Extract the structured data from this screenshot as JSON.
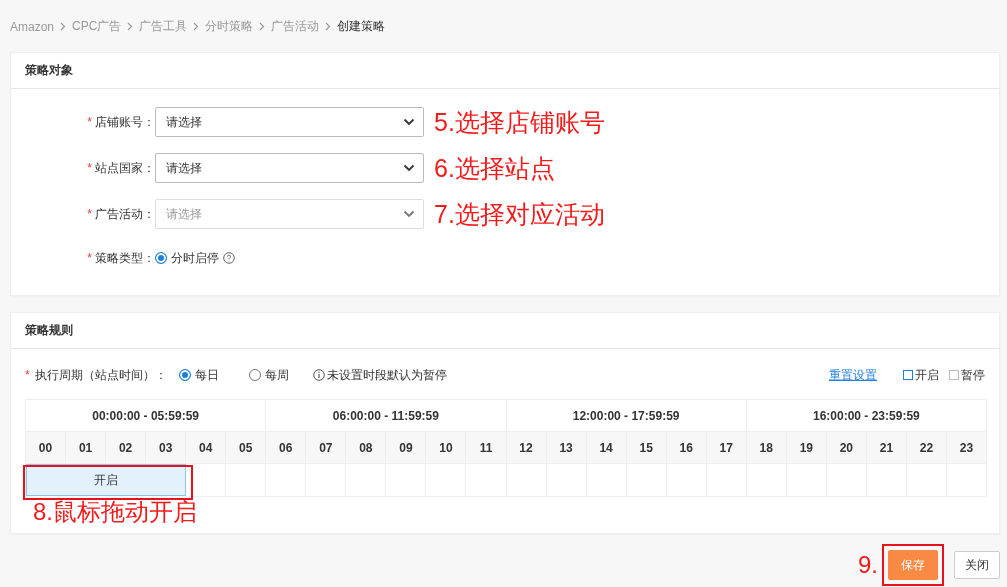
{
  "breadcrumb": [
    {
      "label": "Amazon",
      "current": false
    },
    {
      "label": "CPC广告",
      "current": false
    },
    {
      "label": "广告工具",
      "current": false
    },
    {
      "label": "分时策略",
      "current": false
    },
    {
      "label": "广告活动",
      "current": false
    },
    {
      "label": "创建策略",
      "current": true
    }
  ],
  "target_section": {
    "title": "策略对象",
    "fields": [
      {
        "kind": "select",
        "label": "店铺账号：",
        "required_mark": "*",
        "placeholder": "请选择",
        "disabled": false,
        "annotation": "5.选择店铺账号"
      },
      {
        "kind": "select",
        "label": "站点国家：",
        "required_mark": "*",
        "placeholder": "请选择",
        "disabled": false,
        "annotation": "6.选择站点"
      },
      {
        "kind": "select",
        "label": "广告活动：",
        "required_mark": "*",
        "placeholder": "请选择",
        "disabled": true,
        "annotation": "7.选择对应活动"
      },
      {
        "kind": "radio",
        "label": "策略类型：",
        "required_mark": "*",
        "options": [
          {
            "label": "分时启停",
            "selected": true
          }
        ]
      }
    ]
  },
  "rules_section": {
    "title": "策略规则",
    "period_label": "执行周期（站点时间）：",
    "period_required_mark": "*",
    "period_options": [
      {
        "label": "每日",
        "selected": true
      },
      {
        "label": "每周",
        "selected": false
      }
    ],
    "hint": "未设置时段默认为暂停",
    "reset_link": "重置设置",
    "legend": [
      {
        "label": "开启",
        "kind": "on"
      },
      {
        "label": "暂停",
        "kind": "off"
      }
    ],
    "ranges": [
      "00:00:00 - 05:59:59",
      "06:00:00 - 11:59:59",
      "12:00:00 - 17:59:59",
      "16:00:00 - 23:59:59"
    ],
    "hours": [
      {
        "label": "00",
        "on": true
      },
      {
        "label": "01",
        "on": true
      },
      {
        "label": "02",
        "on": true
      },
      {
        "label": "03",
        "on": true
      },
      {
        "label": "04",
        "on": false
      },
      {
        "label": "05",
        "on": false
      },
      {
        "label": "06",
        "on": false
      },
      {
        "label": "07",
        "on": false
      },
      {
        "label": "08",
        "on": false
      },
      {
        "label": "09",
        "on": false
      },
      {
        "label": "10",
        "on": false
      },
      {
        "label": "11",
        "on": false
      },
      {
        "label": "12",
        "on": false
      },
      {
        "label": "13",
        "on": false
      },
      {
        "label": "14",
        "on": false
      },
      {
        "label": "15",
        "on": false
      },
      {
        "label": "16",
        "on": false
      },
      {
        "label": "17",
        "on": false
      },
      {
        "label": "18",
        "on": false
      },
      {
        "label": "19",
        "on": false
      },
      {
        "label": "20",
        "on": false
      },
      {
        "label": "21",
        "on": false
      },
      {
        "label": "22",
        "on": false
      },
      {
        "label": "23",
        "on": false
      }
    ],
    "segment_label": "开启",
    "annotation": "8.鼠标拖动开启"
  },
  "footer": {
    "annotation": "9.",
    "buttons": [
      {
        "label": "保存",
        "kind": "primary"
      },
      {
        "label": "关闭",
        "kind": "default"
      }
    ]
  }
}
